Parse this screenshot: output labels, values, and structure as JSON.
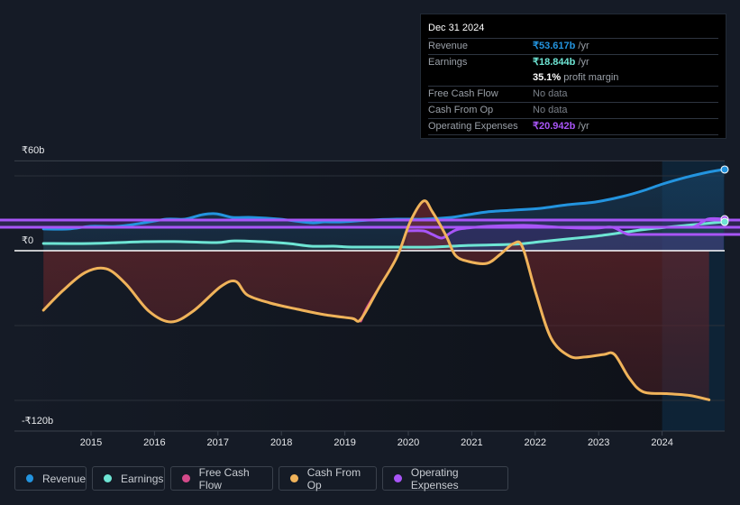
{
  "tooltip": {
    "date": "Dec 31 2024",
    "rows": [
      {
        "label": "Revenue",
        "value": "₹53.617b",
        "unit": " /yr",
        "color": "#2394df"
      },
      {
        "label": "Earnings",
        "value": "₹18.844b",
        "unit": " /yr",
        "color": "#6ee5d4"
      },
      {
        "label": "",
        "value": "35.1%",
        "unit": " profit margin",
        "color": "#ffffff"
      },
      {
        "label": "Free Cash Flow",
        "value": "No data",
        "unit": "",
        "color": "#7a8089"
      },
      {
        "label": "Cash From Op",
        "value": "No data",
        "unit": "",
        "color": "#7a8089"
      },
      {
        "label": "Operating Expenses",
        "value": "₹20.942b",
        "unit": " /yr",
        "color": "#a855f7"
      }
    ]
  },
  "legend": [
    {
      "label": "Revenue",
      "color": "#2394df"
    },
    {
      "label": "Earnings",
      "color": "#6ee5d4"
    },
    {
      "label": "Free Cash Flow",
      "color": "#d44a8a"
    },
    {
      "label": "Cash From Op",
      "color": "#f0b35a"
    },
    {
      "label": "Operating Expenses",
      "color": "#a855f7"
    }
  ],
  "chart_data": {
    "type": "line",
    "title": "",
    "xlabel": "",
    "ylabel": "",
    "currency": "₹",
    "y_ticks": [
      {
        "value": 60,
        "label": "₹60b"
      },
      {
        "value": 0,
        "label": "₹0"
      },
      {
        "value": -120,
        "label": "-₹120b"
      }
    ],
    "ylim": [
      -144,
      72
    ],
    "xlim": [
      2014.25,
      2024.99
    ],
    "x_ticks": [
      2015,
      2016,
      2017,
      2018,
      2019,
      2020,
      2021,
      2022,
      2023,
      2024
    ],
    "forecast_shade_start": 2024.0,
    "grid": true,
    "legend_position": "bottom",
    "series": [
      {
        "name": "Revenue",
        "color": "#2394df",
        "x": [
          2014.25,
          2014.64,
          2014.99,
          2015.41,
          2015.84,
          2016.19,
          2016.48,
          2016.76,
          2016.98,
          2017.23,
          2017.54,
          2017.97,
          2018.47,
          2018.68,
          2018.96,
          2019.39,
          2019.82,
          2020.24,
          2020.67,
          2020.95,
          2021.24,
          2021.66,
          2022.09,
          2022.51,
          2022.94,
          2023.37,
          2023.72,
          2024.01,
          2024.36,
          2024.72,
          2024.97
        ],
        "values": [
          17.4,
          17.4,
          19.5,
          19.5,
          22.4,
          25.3,
          25.3,
          28.9,
          29.6,
          26.7,
          26.7,
          25.3,
          22.4,
          23.1,
          23.1,
          24.6,
          25.3,
          25.3,
          26.7,
          28.9,
          31.1,
          32.5,
          34.0,
          36.9,
          39.0,
          43.4,
          48.4,
          53.5,
          58.6,
          62.9,
          65.1
        ]
      },
      {
        "name": "Earnings",
        "color": "#6ee5d4",
        "x": [
          2014.25,
          2014.99,
          2015.84,
          2016.41,
          2016.98,
          2017.26,
          2017.69,
          2018.11,
          2018.47,
          2018.82,
          2019.11,
          2019.82,
          2020.38,
          2020.95,
          2021.66,
          2022.09,
          2022.51,
          2022.94,
          2023.37,
          2023.79,
          2024.36,
          2024.97
        ],
        "values": [
          5.8,
          5.8,
          7.2,
          7.2,
          6.5,
          7.9,
          7.2,
          5.8,
          3.6,
          3.6,
          2.9,
          2.9,
          2.9,
          4.3,
          5.1,
          7.2,
          9.4,
          11.6,
          14.5,
          17.4,
          20.2,
          23.1
        ]
      },
      {
        "name": "Operating Expenses",
        "color": "#a855f7",
        "x": [
          2019.98,
          2020.24,
          2020.38,
          2020.53,
          2020.67,
          2020.81,
          2021.24,
          2021.66,
          2021.94,
          2022.37,
          2022.94,
          2023.22,
          2023.48,
          2023.68,
          224.0,
          2024.25,
          2024.47,
          2024.72,
          2024.97
        ],
        "values": [
          15.9,
          15.9,
          13.0,
          10.1,
          14.5,
          17.4,
          19.5,
          20.2,
          20.2,
          18.8,
          18.1,
          18.8,
          13.0,
          18.8,
          21.7,
          24.6,
          18.8,
          25.3,
          25.3
        ]
      },
      {
        "name": "Cash From Op",
        "color": "#f0b35a",
        "x": [
          2014.25,
          2014.56,
          2014.91,
          2015.24,
          2015.55,
          2015.91,
          2016.26,
          2016.61,
          2017.04,
          2017.28,
          2017.46,
          2017.82,
          2018.25,
          2018.68,
          2019.11,
          2019.25,
          2019.53,
          2019.82,
          2020.03,
          2020.24,
          2020.38,
          2020.6,
          2020.74,
          2020.95,
          2021.24,
          2021.45,
          2021.66,
          2021.8,
          2022.01,
          2022.25,
          2022.54,
          2022.79,
          2023.08,
          2023.25,
          2023.48,
          2023.7,
          2024.07,
          2024.43,
          2024.74
        ],
        "values": [
          -47.7,
          -31.8,
          -17.4,
          -14.5,
          -26.7,
          -48.4,
          -57.1,
          -48.4,
          -28.9,
          -24.6,
          -35.4,
          -41.9,
          -46.9,
          -51.3,
          -54.2,
          -55.0,
          -30.4,
          -5.1,
          23.1,
          39.8,
          31.1,
          11.6,
          -3.6,
          -8.7,
          -10.1,
          -2.9,
          5.8,
          2.9,
          -34.0,
          -70.1,
          -84.5,
          -85.2,
          -83.2,
          -83.2,
          -102.0,
          -113.1,
          -114.6,
          -116.0,
          -119.6
        ]
      },
      {
        "name": "Free Cash Flow",
        "color": "#d44a8a",
        "x": [
          2019.25,
          2019.35,
          2019.5
        ],
        "values": [
          -56.4,
          -45.6,
          -33.0
        ]
      }
    ]
  }
}
